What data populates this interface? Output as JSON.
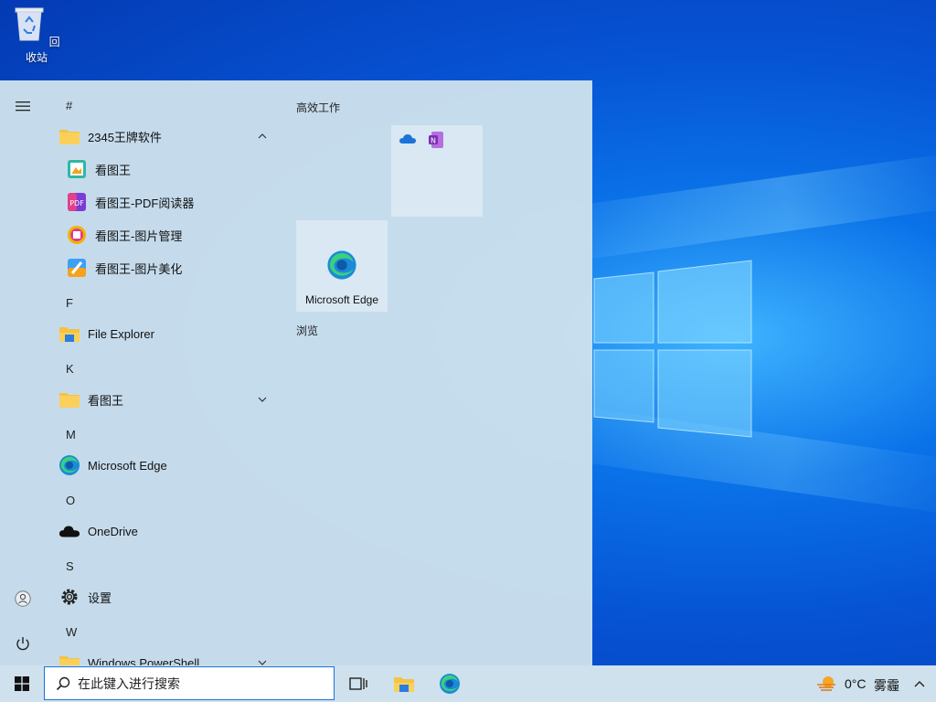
{
  "desktop": {
    "recycle_bin_label": "回收站"
  },
  "start_menu": {
    "letters": {
      "hash": "#",
      "f": "F",
      "k": "K",
      "m": "M",
      "o": "O",
      "s": "S",
      "w": "W"
    },
    "apps": {
      "folder_2345": "2345王牌软件",
      "kantuwang": "看图王",
      "kantuwang_pdf": "看图王-PDF阅读器",
      "kantuwang_pic": "看图王-图片管理",
      "kantuwang_beauty": "看图王-图片美化",
      "file_explorer": "File Explorer",
      "folder_kantuwang": "看图王",
      "edge": "Microsoft Edge",
      "onedrive": "OneDrive",
      "settings": "设置",
      "powershell": "Windows PowerShell"
    },
    "tiles": {
      "group1_title": "高效工作",
      "edge_tile_label": "Microsoft Edge",
      "group2_title": "浏览"
    }
  },
  "taskbar": {
    "search_placeholder": "在此键入进行搜索",
    "temperature": "0°C",
    "weather": "雾霾"
  },
  "colors": {
    "accent": "#1a73d9",
    "start_bg": "#cbe0ec",
    "folder": "#f5c242"
  }
}
